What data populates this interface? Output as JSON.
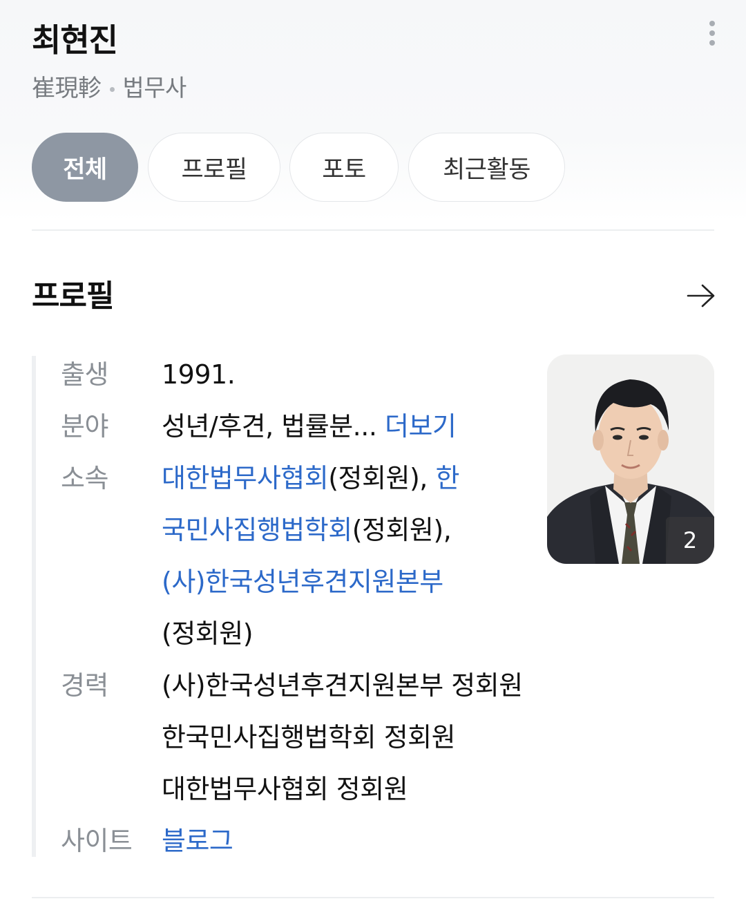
{
  "header": {
    "name": "최현진",
    "hanja": "崔現軫",
    "occupation": "법무사"
  },
  "tabs": [
    {
      "label": "전체",
      "active": true
    },
    {
      "label": "프로필",
      "active": false
    },
    {
      "label": "포토",
      "active": false
    },
    {
      "label": "최근활동",
      "active": false
    }
  ],
  "profile": {
    "title": "프로필",
    "rows": {
      "birth": {
        "label": "출생",
        "value": "1991."
      },
      "field": {
        "label": "분야",
        "value": "성년/후견, 법률분...",
        "more": "더보기"
      },
      "affiliation": {
        "label": "소속",
        "org1": "대한법무사협회",
        "org1_suffix": "(정회원), ",
        "org2_part1": "한",
        "org2_part2": "국민사집행법학회",
        "org2_suffix": "(정회원),",
        "org3": "(사)한국성년후견지원본부",
        "org3_suffix": "(정회원)"
      },
      "career": {
        "label": "경력",
        "items": [
          "(사)한국성년후견지원본부 정회원",
          "한국민사집행법학회 정회원",
          "대한법무사협회 정회원"
        ]
      },
      "site": {
        "label": "사이트",
        "value": "블로그"
      }
    },
    "photo": {
      "count": "2"
    }
  },
  "colors": {
    "accent_link": "#2c69c9",
    "tab_active": "#8e97a3",
    "label_gray": "#8a8f95"
  }
}
